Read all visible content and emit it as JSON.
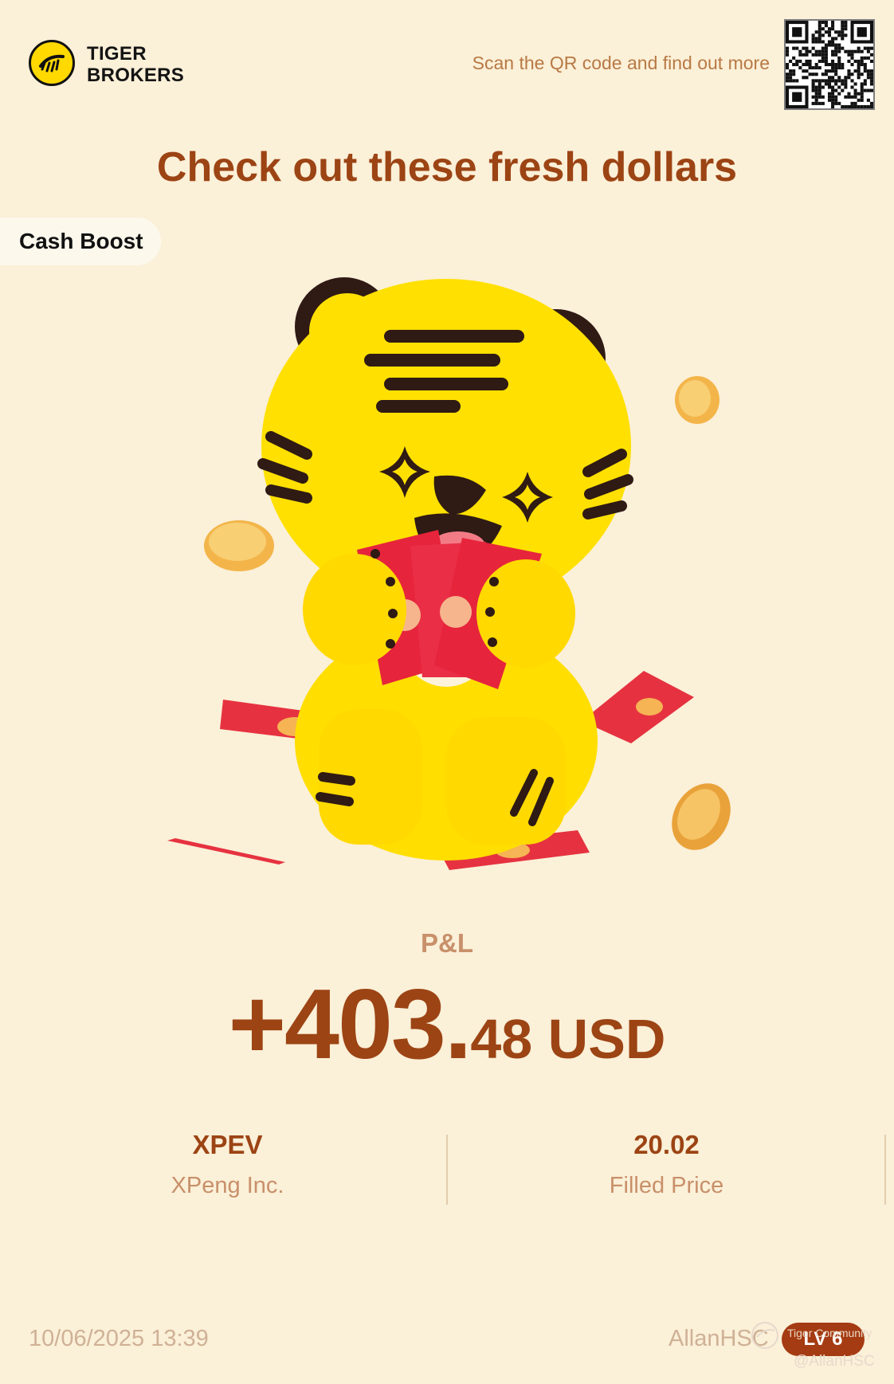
{
  "brand": {
    "line1": "TIGER",
    "line2": "BROKERS"
  },
  "header": {
    "scan_text": "Scan the QR code and find out more"
  },
  "headline": "Check out these fresh dollars",
  "tag": "Cash Boost",
  "pl": {
    "label": "P&L",
    "amount_int": "+403.",
    "amount_dec": "48 USD"
  },
  "stock": {
    "ticker": "XPEV",
    "name": "XPeng Inc."
  },
  "price": {
    "value": "20.02",
    "label": "Filled Price"
  },
  "footer": {
    "datetime": "10/06/2025 13:39",
    "username": "AllanHSC",
    "level": "LV 6",
    "watermark_line1": "Tiger Community",
    "watermark_line2": "@AllanHSC"
  },
  "icons": [
    "tiger-logo-icon",
    "qr-code",
    "tiger-mascot-illustration",
    "watermark-logo-icon"
  ],
  "colors": {
    "background": "#fbf0d8",
    "accent": "#9c4414",
    "muted": "#c8906a",
    "badge": "#a53b12"
  }
}
